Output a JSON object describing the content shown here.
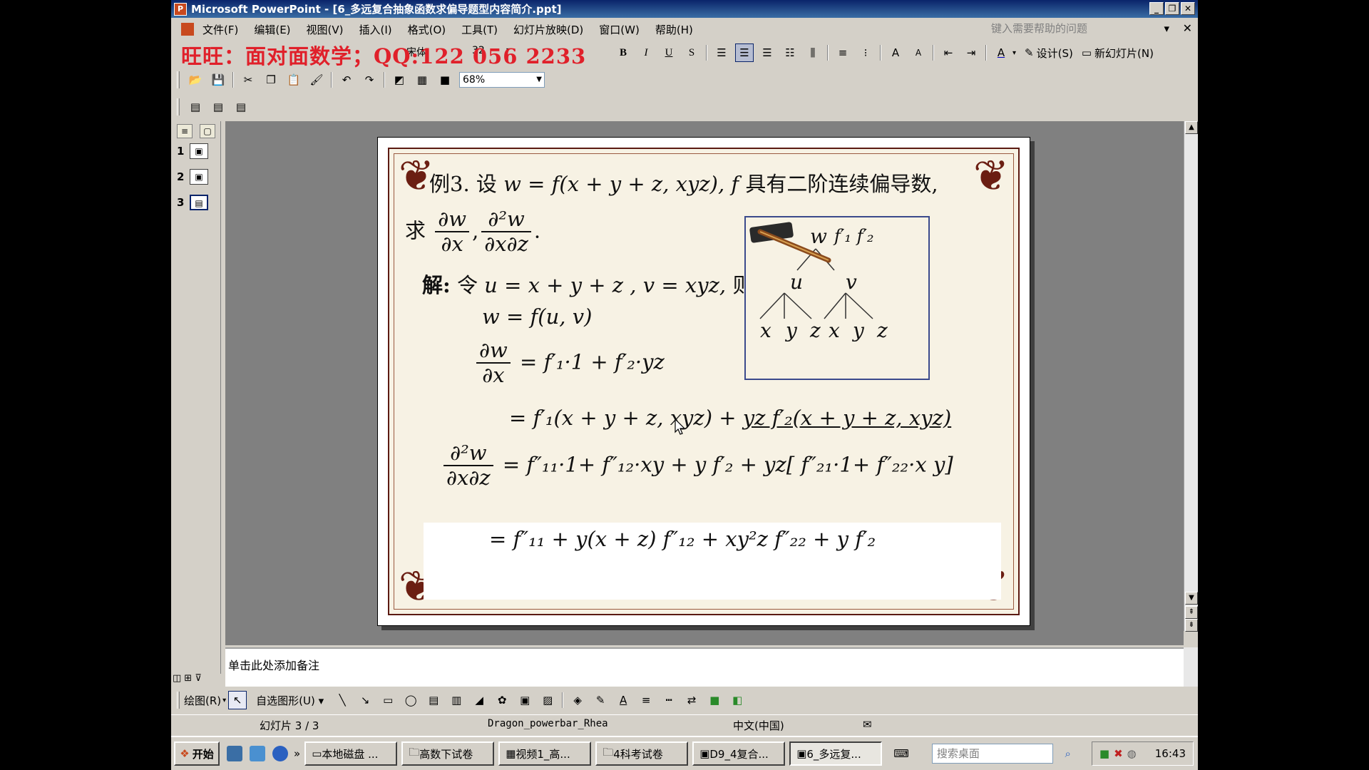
{
  "window": {
    "title": "Microsoft PowerPoint - [6_多远复合抽象函数求偏导题型内容简介.ppt]",
    "controls": [
      "_",
      "❐",
      "✕"
    ]
  },
  "menu": {
    "items": [
      "文件(F)",
      "编辑(E)",
      "视图(V)",
      "插入(I)",
      "格式(O)",
      "工具(T)",
      "幻灯片放映(D)",
      "窗口(W)",
      "帮助(H)"
    ],
    "help_placeholder": "键入需要帮助的问题",
    "close": "✕"
  },
  "banner": {
    "text": "旺旺：面对面数学；QQ:122 056 2233"
  },
  "toolbar": {
    "font_name": "宋体",
    "font_size": "32",
    "bold": "B",
    "italic": "I",
    "underline": "U",
    "shadow": "S",
    "design_label": "设计(S)",
    "new_slide_label": "新幻灯片(N)",
    "zoom": "68%"
  },
  "slides_pane": {
    "thumbs": [
      {
        "num": "1"
      },
      {
        "num": "2"
      },
      {
        "num": "3"
      }
    ],
    "selected": 3
  },
  "slide": {
    "line1_prefix": "例3. 设",
    "line1_formula": "w = f(x + y + z, xyz),",
    "line1_suffix_f": "f",
    "line1_suffix": " 具有二阶连续偏导数,",
    "find_label": "求",
    "frac1_num": "∂w",
    "frac1_den": "∂x",
    "frac2_num": "∂²w",
    "frac2_den": "∂x∂z",
    "sol_label": "解:",
    "sol_let": "令",
    "sol_subs": "u = x + y + z , v = xyz,",
    "sol_then": "则",
    "eq_wuv": "w = f(u, v)",
    "eq_dwdx_rhs": "= f′₁·1 + f′₂·yz",
    "eq_expand_a": "= f′₁(x + y + z, xyz) + ",
    "eq_expand_b": "yz f′₂(x + y + z, xyz)",
    "eq_d2_rhs": "= f″₁₁·1+ f″₁₂·xy + y f′₂ + yz[ f″₂₁·1+ f″₂₂·x y]",
    "eq_final": "= f″₁₁ + y(x + z) f″₁₂ + xy²z f″₂₂ + y f′₂",
    "tree": {
      "root": "w",
      "root_args": "f′₁ f′₂",
      "mid": [
        "u",
        "v"
      ],
      "leaves": [
        "x",
        "y",
        "z",
        "x",
        "y",
        "z"
      ]
    }
  },
  "notes": {
    "placeholder": "单击此处添加备注"
  },
  "drawbar": {
    "draw_label": "绘图(R)",
    "autoshapes_label": "自选图形(U)"
  },
  "status": {
    "slide_counter": "幻灯片 3 / 3",
    "design": "Dragon_powerbar_Rhea",
    "language": "中文(中国)"
  },
  "taskbar": {
    "start": "开始",
    "tasks": [
      "本地磁盘 ...",
      "高数下试卷",
      "视频1_高...",
      "4科考试卷",
      "D9_4复合...",
      "6_多远复..."
    ],
    "active_task": 5,
    "search_placeholder": "搜索桌面",
    "clock": "16:43"
  },
  "colors": {
    "banner_red": "#e0202a",
    "title_blue": "#0a246a",
    "slide_border": "#5b1a12",
    "tree_border": "#3b4a8c"
  }
}
